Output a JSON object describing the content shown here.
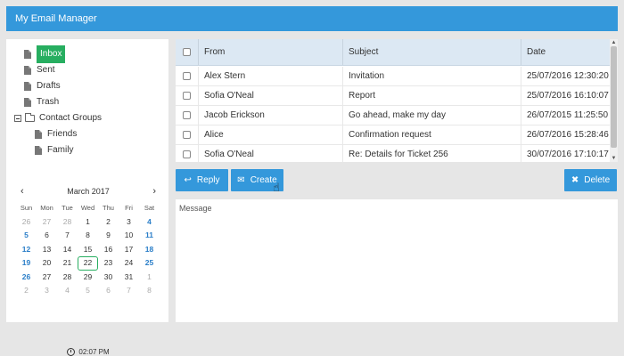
{
  "app": {
    "title": "My Email Manager"
  },
  "tree": {
    "inbox": "Inbox",
    "sent": "Sent",
    "drafts": "Drafts",
    "trash": "Trash",
    "contact_groups": "Contact Groups",
    "friends": "Friends",
    "family": "Family"
  },
  "calendar": {
    "month": "March 2017",
    "prev": "‹",
    "next": "›",
    "dow": [
      "Sun",
      "Mon",
      "Tue",
      "Wed",
      "Thu",
      "Fri",
      "Sat"
    ],
    "weeks": [
      [
        "26",
        "27",
        "28",
        "1",
        "2",
        "3",
        "4"
      ],
      [
        "5",
        "6",
        "7",
        "8",
        "9",
        "10",
        "11"
      ],
      [
        "12",
        "13",
        "14",
        "15",
        "16",
        "17",
        "18"
      ],
      [
        "19",
        "20",
        "21",
        "22",
        "23",
        "24",
        "25"
      ],
      [
        "26",
        "27",
        "28",
        "29",
        "30",
        "31",
        "1"
      ],
      [
        "2",
        "3",
        "4",
        "5",
        "6",
        "7",
        "8"
      ]
    ],
    "today": "22",
    "time": "02:07 PM"
  },
  "grid": {
    "headers": {
      "from": "From",
      "subject": "Subject",
      "date": "Date"
    },
    "rows": [
      {
        "from": "Alex Stern",
        "subject": "Invitation",
        "date": "25/07/2016 12:30:20"
      },
      {
        "from": "Sofia O'Neal",
        "subject": "Report",
        "date": "25/07/2016 16:10:07"
      },
      {
        "from": "Jacob Erickson",
        "subject": "Go ahead, make my day",
        "date": "26/07/2015 11:25:50"
      },
      {
        "from": "Alice",
        "subject": "Confirmation request",
        "date": "26/07/2016 15:28:46"
      },
      {
        "from": "Sofia O'Neal",
        "subject": "Re: Details for Ticket 256",
        "date": "30/07/2016 17:10:17"
      }
    ]
  },
  "toolbar": {
    "reply": "Reply",
    "create": "Create",
    "delete": "Delete"
  },
  "message": {
    "label": "Message"
  },
  "colors": {
    "accent": "#3498db",
    "selected": "#27ae60",
    "header": "#dce8f3"
  }
}
